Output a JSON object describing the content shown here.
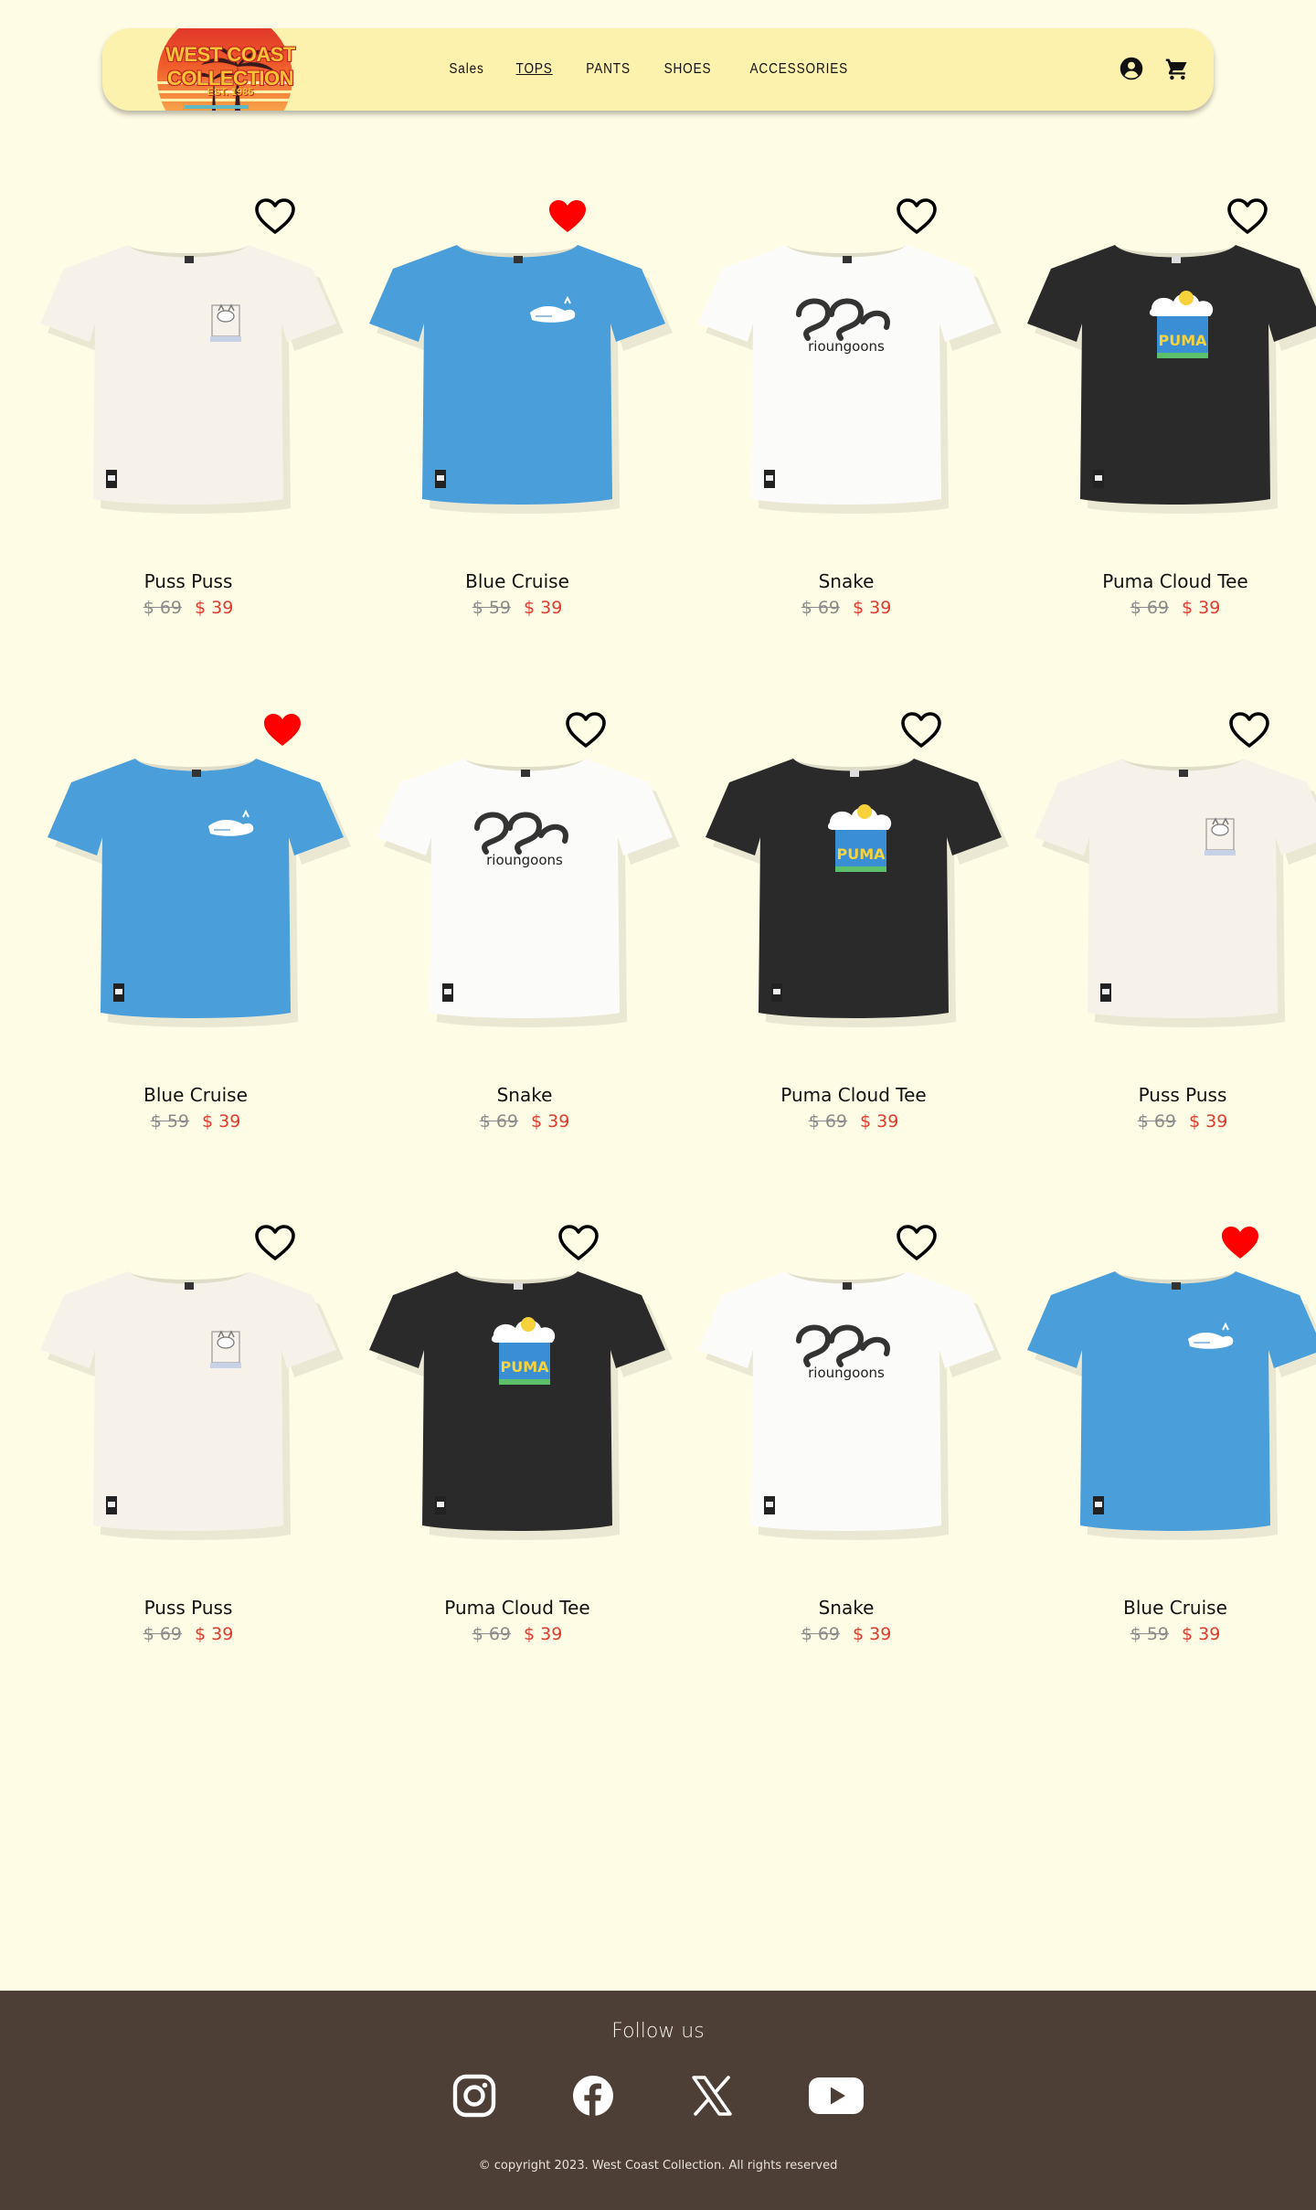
{
  "brand": {
    "name": "West Coast Collection",
    "logo_title": "WEST COAST COLLECTION",
    "logo_est": "EST. 1985"
  },
  "nav": {
    "items": [
      {
        "label": "Sales",
        "active": false
      },
      {
        "label": "TOPS",
        "active": true
      },
      {
        "label": "PANTS",
        "active": false
      },
      {
        "label": "SHOES",
        "active": false
      },
      {
        "label": "ACCESSORIES",
        "active": false
      }
    ]
  },
  "header_icons": [
    "account-icon",
    "cart-icon"
  ],
  "products": [
    {
      "name": "Puss Puss",
      "old_price": "$ 69",
      "price": "$ 39",
      "color": "#f6f2ea",
      "favorited": false,
      "graphic": "cat"
    },
    {
      "name": "Blue Cruise",
      "old_price": "$ 59",
      "price": "$ 39",
      "color": "#4a9fdb",
      "favorited": true,
      "graphic": "cat-blue"
    },
    {
      "name": "Snake",
      "old_price": "$ 69",
      "price": "$ 39",
      "color": "#fbfbfa",
      "favorited": false,
      "graphic": "snake"
    },
    {
      "name": "Puma Cloud Tee",
      "old_price": "$ 69",
      "price": "$ 39",
      "color": "#2a2a2a",
      "favorited": false,
      "graphic": "cloud"
    },
    {
      "name": "Blue Cruise",
      "old_price": "$ 59",
      "price": "$ 39",
      "color": "#4a9fdb",
      "favorited": true,
      "graphic": "cat-blue"
    },
    {
      "name": "Snake",
      "old_price": "$ 69",
      "price": "$ 39",
      "color": "#fbfbfa",
      "favorited": false,
      "graphic": "snake"
    },
    {
      "name": "Puma Cloud Tee",
      "old_price": "$ 69",
      "price": "$ 39",
      "color": "#2a2a2a",
      "favorited": false,
      "graphic": "cloud"
    },
    {
      "name": "Puss Puss",
      "old_price": "$ 69",
      "price": "$ 39",
      "color": "#f6f2ea",
      "favorited": false,
      "graphic": "cat"
    },
    {
      "name": "Puss Puss",
      "old_price": "$ 69",
      "price": "$ 39",
      "color": "#f6f2ea",
      "favorited": false,
      "graphic": "cat"
    },
    {
      "name": "Puma Cloud Tee",
      "old_price": "$ 69",
      "price": "$ 39",
      "color": "#2a2a2a",
      "favorited": false,
      "graphic": "cloud"
    },
    {
      "name": "Snake",
      "old_price": "$ 69",
      "price": "$ 39",
      "color": "#fbfbfa",
      "favorited": false,
      "graphic": "snake"
    },
    {
      "name": "Blue Cruise",
      "old_price": "$ 59",
      "price": "$ 39",
      "color": "#4a9fdb",
      "favorited": true,
      "graphic": "cat-blue"
    }
  ],
  "footer": {
    "follow_label": "Follow us",
    "socials": [
      "instagram-icon",
      "facebook-icon",
      "x-icon",
      "youtube-icon"
    ],
    "copyright": "© copyright 2023. West Coast Collection. All rights reserved"
  },
  "colors": {
    "page_bg": "#fefce4",
    "header_bg": "#fdf1ae",
    "footer_bg": "#4d3e36",
    "sale_price": "#e23a2c",
    "heart_active": "#ff0000"
  }
}
